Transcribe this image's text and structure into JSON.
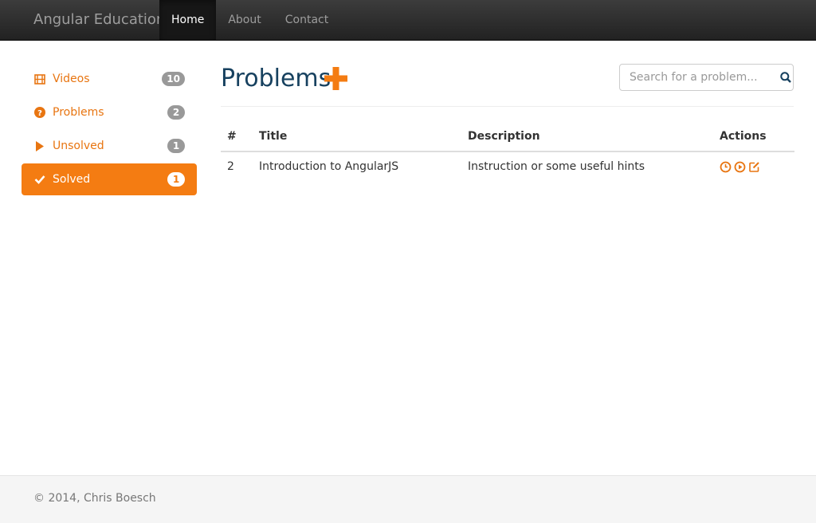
{
  "navbar": {
    "brand": "Angular Education",
    "items": [
      {
        "label": "Home",
        "active": true
      },
      {
        "label": "About",
        "active": false
      },
      {
        "label": "Contact",
        "active": false
      }
    ]
  },
  "sidebar": {
    "items": [
      {
        "label": "Videos",
        "count": "10",
        "icon": "film-icon",
        "active": false
      },
      {
        "label": "Problems",
        "count": "2",
        "icon": "question-circle-icon",
        "active": false
      },
      {
        "label": "Unsolved",
        "count": "1",
        "icon": "play-icon",
        "active": false
      },
      {
        "label": "Solved",
        "count": "1",
        "icon": "check-icon",
        "active": true
      }
    ]
  },
  "main": {
    "title": "Problems",
    "add_icon": "plus-icon",
    "search": {
      "placeholder": "Search for a problem...",
      "value": "",
      "icon": "search-icon"
    },
    "table": {
      "headers": [
        "#",
        "Title",
        "Description",
        "Actions"
      ],
      "rows": [
        {
          "num": "2",
          "title": "Introduction to AngularJS",
          "description": "Instruction or some useful hints",
          "actions": [
            "clock-icon",
            "play-circle-icon",
            "edit-icon"
          ]
        }
      ]
    }
  },
  "footer": {
    "text": "© 2014, Chris Boesch"
  },
  "colors": {
    "accent": "#f47c12",
    "title": "#17415f",
    "navbar": "#222222"
  }
}
